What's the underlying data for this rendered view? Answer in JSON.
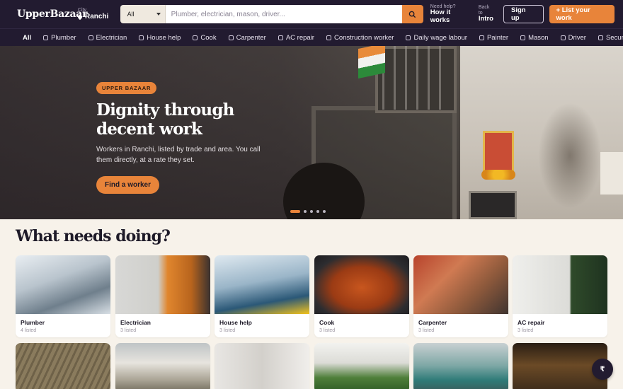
{
  "header": {
    "logo": "UpperBazaar",
    "city_label": "City",
    "city_value": "Ranchi",
    "search_category": "All",
    "search_placeholder": "Plumber, electrician, mason, driver...",
    "help_small": "Need help?",
    "help_big": "How it works",
    "intro_small": "Back to",
    "intro_big": "Intro",
    "signup": "Sign up",
    "list_work": "+ List your work"
  },
  "nav": {
    "items": [
      "All",
      "Plumber",
      "Electrician",
      "House help",
      "Cook",
      "Carpenter",
      "AC repair",
      "Construction worker",
      "Daily wage labour",
      "Painter",
      "Mason",
      "Driver",
      "Security"
    ]
  },
  "hero": {
    "badge": "UPPER BAZAAR",
    "title_line1": "Dignity through",
    "title_line2": "decent work",
    "body": "Workers in Ranchi, listed by trade and area. You call them directly, at a rate they set.",
    "cta": "Find a worker",
    "slides_total": 5,
    "slide_active": 1
  },
  "section": {
    "title": "What needs doing?"
  },
  "cards": [
    {
      "name": "Plumber",
      "count": "4 listed"
    },
    {
      "name": "Electrician",
      "count": "3 listed"
    },
    {
      "name": "House help",
      "count": "3 listed"
    },
    {
      "name": "Cook",
      "count": "3 listed"
    },
    {
      "name": "Carpenter",
      "count": "3 listed"
    },
    {
      "name": "AC repair",
      "count": "3 listed"
    }
  ],
  "fab_label": "₹",
  "colors": {
    "brand_dark": "#221b30",
    "accent": "#e8843a",
    "background": "#f7f2ea"
  }
}
